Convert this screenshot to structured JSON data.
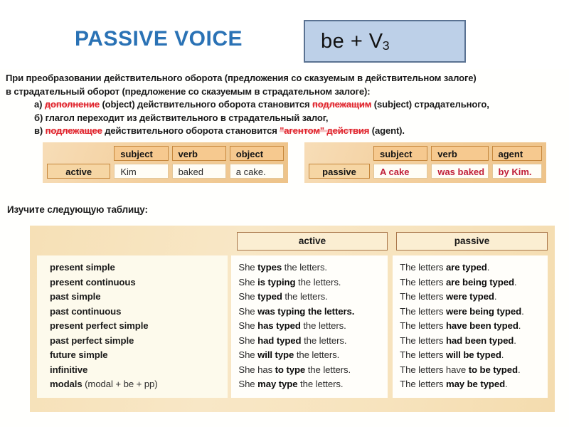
{
  "slide": {
    "title": "PASSIVE VOICE",
    "title_color": "#2a72b5",
    "formula": "be + V",
    "formula_sub": "3",
    "formula_box_color": "#bdd0e8",
    "formula_border_color": "#5a7292"
  },
  "explanation": {
    "line1": "При преобразовании действительного оборота (предложения со сказуемым в действительном залоге)",
    "line2": "в страдательный оборот (предложение со сказуемым в страдательном залоге):",
    "a": {
      "marker": "а) ",
      "red1": "дополнение",
      "mid1": " (object) действительного оборота становится ",
      "red2": "подлежащим",
      "mid2": " (subject) страдательного,"
    },
    "b": {
      "marker": "б) ",
      "text": "глагол переходит из действительного в страдательный залог,"
    },
    "v": {
      "marker": "в) ",
      "red1": "подлежащее",
      "mid1": " действительного оборота становится ",
      "red2": "\"агентом\" действия",
      "mid2": " (agent)."
    },
    "highlight_color": "#e0242c"
  },
  "example_active": {
    "headers": [
      "subject",
      "verb",
      "object"
    ],
    "row_label": "active",
    "cells": [
      "Kim",
      "baked",
      "a cake."
    ]
  },
  "example_passive": {
    "headers": [
      "subject",
      "verb",
      "agent"
    ],
    "row_label": "passive",
    "cells": [
      "A cake",
      "was baked",
      "by Kim."
    ],
    "cell_color": "#c0203a"
  },
  "study_caption": "Изучите следующую таблицу:",
  "tense_table": {
    "col_headers": [
      "active",
      "passive"
    ],
    "rows": [
      {
        "tense": "present simple",
        "tense_extra": "",
        "active_pre": "She ",
        "active_bold": "types",
        "active_post": " the letters.",
        "passive_pre": "The letters ",
        "passive_bold": "are typed",
        "passive_post": "."
      },
      {
        "tense": "present continuous",
        "tense_extra": "",
        "active_pre": "She ",
        "active_bold": "is typing",
        "active_post": " the letters.",
        "passive_pre": "The letters ",
        "passive_bold": "are being typed",
        "passive_post": "."
      },
      {
        "tense": "past simple",
        "tense_extra": "",
        "active_pre": "She ",
        "active_bold": "typed",
        "active_post": " the letters.",
        "passive_pre": "The letters ",
        "passive_bold": "were typed",
        "passive_post": "."
      },
      {
        "tense": "past continuous",
        "tense_extra": "",
        "active_pre": "She ",
        "active_bold": "was typing the letters.",
        "active_post": "",
        "passive_pre": "The letters ",
        "passive_bold": "were being typed",
        "passive_post": "."
      },
      {
        "tense": "present perfect simple",
        "tense_extra": "",
        "active_pre": "She ",
        "active_bold": "has typed",
        "active_post": " the letters.",
        "passive_pre": "The letters ",
        "passive_bold": "have been typed",
        "passive_post": "."
      },
      {
        "tense": "past perfect simple",
        "tense_extra": "",
        "active_pre": "She ",
        "active_bold": "had typed",
        "active_post": " the letters.",
        "passive_pre": "The letters ",
        "passive_bold": "had been typed",
        "passive_post": "."
      },
      {
        "tense": "future simple",
        "tense_extra": "",
        "active_pre": "She ",
        "active_bold": "will type",
        "active_post": " the letters.",
        "passive_pre": "The letters ",
        "passive_bold": "will be typed",
        "passive_post": "."
      },
      {
        "tense": "infinitive",
        "tense_extra": "",
        "active_pre": "She has ",
        "active_bold": "to type",
        "active_post": " the letters.",
        "passive_pre": "The letters have ",
        "passive_bold": "to be typed",
        "passive_post": "."
      },
      {
        "tense": "modals",
        "tense_extra": " (modal + be + pp)",
        "active_pre": "She ",
        "active_bold": "may type",
        "active_post": " the letters.",
        "passive_pre": "The letters ",
        "passive_bold": "may be typed",
        "passive_post": "."
      }
    ]
  }
}
